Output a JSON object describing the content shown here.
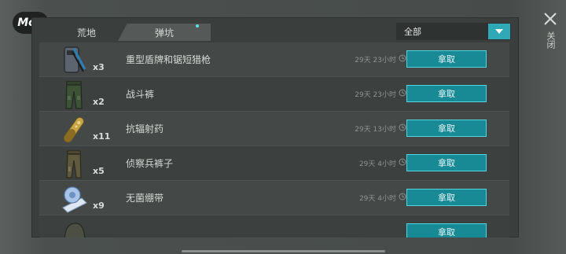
{
  "mod_badge": "Mod",
  "tabs": [
    {
      "label": "荒地"
    },
    {
      "label": "弹坑"
    }
  ],
  "filter": {
    "selected": "全部"
  },
  "close_label": "关闭",
  "items": [
    {
      "name": "重型盾牌和锯短猎枪",
      "qty": "x3",
      "time": "29天 23小时",
      "action": "拿取",
      "icon": "shield-shotgun-icon"
    },
    {
      "name": "战斗裤",
      "qty": "x2",
      "time": "29天 23小时",
      "action": "拿取",
      "icon": "combat-pants-icon"
    },
    {
      "name": "抗辐射药",
      "qty": "x11",
      "time": "29天 13小时",
      "action": "拿取",
      "icon": "anti-radiation-pill-icon"
    },
    {
      "name": "侦察兵裤子",
      "qty": "x5",
      "time": "29天 4小时",
      "action": "拿取",
      "icon": "scout-pants-icon"
    },
    {
      "name": "无菌绷带",
      "qty": "x9",
      "time": "29天 4小时",
      "action": "拿取",
      "icon": "sterile-bandage-icon"
    },
    {
      "name": "",
      "qty": "",
      "time": "",
      "action": "拿取",
      "icon": "scout-helmet-icon"
    }
  ],
  "colors": {
    "accent": "#178a96",
    "accent_border": "#52d6de",
    "panel": "#3a3e3c",
    "tab_dot": "#5de0e0"
  }
}
